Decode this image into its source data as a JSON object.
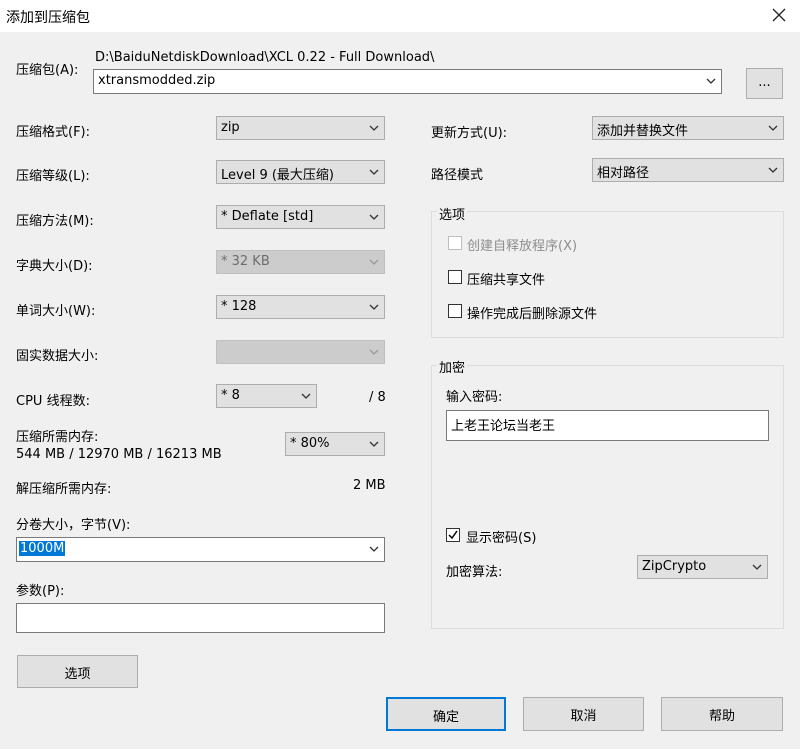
{
  "window": {
    "title": "添加到压缩包"
  },
  "archive": {
    "label": "压缩包(A):",
    "path": "D:\\BaiduNetdiskDownload\\XCL 0.22 - Full Download\\",
    "filename": "xtransmodded.zip",
    "browse_label": "..."
  },
  "left": {
    "format": {
      "label": "压缩格式(F):",
      "value": "zip"
    },
    "level": {
      "label": "压缩等级(L):",
      "value": "Level 9 (最大压缩)"
    },
    "method": {
      "label": "压缩方法(M):",
      "value": "*  Deflate [std]"
    },
    "dict": {
      "label": "字典大小(D):",
      "value": "*  32 KB"
    },
    "word": {
      "label": "单词大小(W):",
      "value": "*  128"
    },
    "solid": {
      "label": "固实数据大小:",
      "value": ""
    },
    "cpu": {
      "label": "CPU 线程数:",
      "value": "*  8",
      "max": "/ 8"
    },
    "mem": {
      "label": "压缩所需内存:",
      "detail": "544 MB / 12970 MB / 16213 MB",
      "value": "* 80%"
    },
    "decomp": {
      "label": "解压缩所需内存:",
      "value": "2 MB"
    },
    "volume": {
      "label": "分卷大小，字节(V):",
      "value": "1000M"
    },
    "params": {
      "label": "参数(P):",
      "value": ""
    },
    "options_button": "选项"
  },
  "right": {
    "update": {
      "label": "更新方式(U):",
      "value": "添加并替换文件"
    },
    "pathmode": {
      "label": "路径模式",
      "value": "相对路径"
    },
    "options_group": {
      "title": "选项",
      "sfx": "创建自释放程序(X)",
      "shared": "压缩共享文件",
      "delete": "操作完成后删除源文件"
    },
    "encrypt_group": {
      "title": "加密",
      "password_label": "输入密码:",
      "password": "上老王论坛当老王",
      "show_password": "显示密码(S)",
      "algo_label": "加密算法:",
      "algo": "ZipCrypto"
    }
  },
  "buttons": {
    "ok": "确定",
    "cancel": "取消",
    "help": "帮助"
  }
}
